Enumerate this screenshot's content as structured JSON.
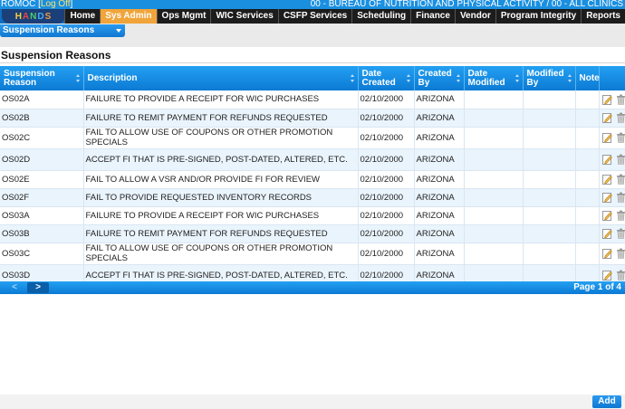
{
  "header": {
    "user": "ROMOC",
    "logoff_label": "Log Off",
    "org": "00 - BUREAU OF NUTRITION AND PHYSICAL ACTIVITY / 00 - ALL CLINICS",
    "logo_text": "HANDS"
  },
  "nav": {
    "tabs": [
      {
        "label": "Home"
      },
      {
        "label": "Sys Admin",
        "active": true
      },
      {
        "label": "Ops Mgmt"
      },
      {
        "label": "WIC Services"
      },
      {
        "label": "CSFP Services"
      },
      {
        "label": "Scheduling"
      },
      {
        "label": "Finance"
      },
      {
        "label": "Vendor"
      },
      {
        "label": "Program Integrity"
      },
      {
        "label": "Reports"
      }
    ]
  },
  "picker": {
    "selected": "Suspension Reasons"
  },
  "page": {
    "title": "Suspension Reasons"
  },
  "grid": {
    "columns": [
      "Suspension Reason",
      "Description",
      "Date Created",
      "Created By",
      "Date Modified",
      "Modified By",
      "Note"
    ],
    "rows": [
      {
        "reason": "OS02A",
        "description": "FAILURE TO PROVIDE A RECEIPT FOR WIC PURCHASES",
        "date_created": "02/10/2000",
        "created_by": "ARIZONA",
        "date_modified": "",
        "modified_by": "",
        "note": ""
      },
      {
        "reason": "OS02B",
        "description": "FAILURE TO REMIT PAYMENT FOR REFUNDS REQUESTED",
        "date_created": "02/10/2000",
        "created_by": "ARIZONA",
        "date_modified": "",
        "modified_by": "",
        "note": ""
      },
      {
        "reason": "OS02C",
        "description": "FAIL TO ALLOW USE OF COUPONS OR OTHER PROMOTION SPECIALS",
        "date_created": "02/10/2000",
        "created_by": "ARIZONA",
        "date_modified": "",
        "modified_by": "",
        "note": ""
      },
      {
        "reason": "OS02D",
        "description": "ACCEPT FI THAT IS PRE-SIGNED, POST-DATED, ALTERED, ETC.",
        "date_created": "02/10/2000",
        "created_by": "ARIZONA",
        "date_modified": "",
        "modified_by": "",
        "note": ""
      },
      {
        "reason": "OS02E",
        "description": "FAIL TO ALLOW A VSR AND/OR PROVIDE FI FOR REVIEW",
        "date_created": "02/10/2000",
        "created_by": "ARIZONA",
        "date_modified": "",
        "modified_by": "",
        "note": ""
      },
      {
        "reason": "OS02F",
        "description": "FAIL TO PROVIDE REQUESTED INVENTORY RECORDS",
        "date_created": "02/10/2000",
        "created_by": "ARIZONA",
        "date_modified": "",
        "modified_by": "",
        "note": ""
      },
      {
        "reason": "OS03A",
        "description": "FAILURE TO PROVIDE A RECEIPT FOR WIC PURCHASES",
        "date_created": "02/10/2000",
        "created_by": "ARIZONA",
        "date_modified": "",
        "modified_by": "",
        "note": ""
      },
      {
        "reason": "OS03B",
        "description": "FAILURE TO REMIT PAYMENT FOR REFUNDS REQUESTED",
        "date_created": "02/10/2000",
        "created_by": "ARIZONA",
        "date_modified": "",
        "modified_by": "",
        "note": ""
      },
      {
        "reason": "OS03C",
        "description": "FAIL TO ALLOW USE OF COUPONS OR OTHER PROMOTION SPECIALS",
        "date_created": "02/10/2000",
        "created_by": "ARIZONA",
        "date_modified": "",
        "modified_by": "",
        "note": ""
      },
      {
        "reason": "OS03D",
        "description": "ACCEPT FI THAT IS PRE-SIGNED, POST-DATED, ALTERED, ETC.",
        "date_created": "02/10/2000",
        "created_by": "ARIZONA",
        "date_modified": "",
        "modified_by": "",
        "note": ""
      }
    ]
  },
  "pager": {
    "prev_label": "<",
    "next_label": ">",
    "info": "Page 1 of 4"
  },
  "footer": {
    "add_label": "Add"
  },
  "colors": {
    "accent": "#1a8fe0",
    "active_tab": "#f0a43a",
    "nav_bg": "#1c1c1c"
  }
}
